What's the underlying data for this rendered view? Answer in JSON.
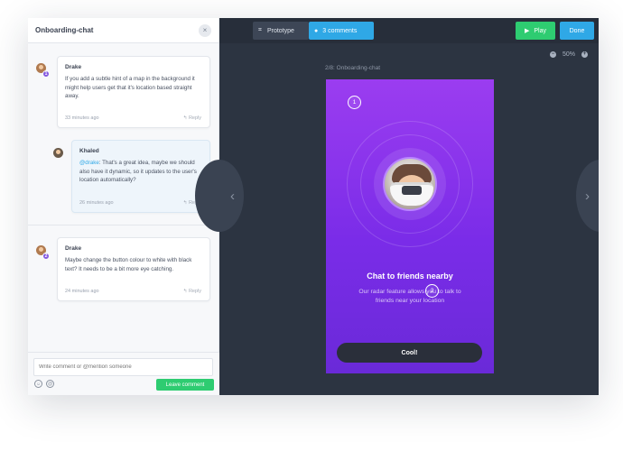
{
  "sidebar": {
    "title": "Onboarding-chat",
    "close_icon": "×",
    "threads": [
      {
        "author": "Drake",
        "badge": "1",
        "text": "If you add a subtle hint of a map in the background it might help users get that it's location based straight away.",
        "time": "33 minutes ago",
        "reply_label": "Reply"
      },
      {
        "author": "Khaled",
        "mention": "@drake",
        "text": ": That's a great idea, maybe we should also have it dynamic, so it updates to the user's location automatically?",
        "time": "26 minutes ago",
        "reply_label": "Reply"
      },
      {
        "author": "Drake",
        "badge": "2",
        "text": "Maybe change the button colour to white with black text? It needs to be a bit more eye catching.",
        "time": "24 minutes ago",
        "reply_label": "Reply"
      }
    ],
    "composer": {
      "placeholder": "Write comment or @mention someone",
      "leave_button": "Leave comment"
    }
  },
  "toolbar": {
    "prototype_label": "Prototype",
    "comments_label": "3 comments",
    "play_label": "Play",
    "done_label": "Done",
    "zoom_level": "50%"
  },
  "canvas": {
    "screen_label": "2/8: Onboarding-chat",
    "phone": {
      "title": "Chat to friends nearby",
      "subtitle": "Our radar feature allows you to talk to friends near your location",
      "button": "Cool!",
      "pin1": "1",
      "pin2": "2"
    }
  },
  "colors": {
    "accent": "#2fa8e6",
    "success": "#2ecc71",
    "badge": "#8358e0",
    "phone_gradient_top": "#9b3df0",
    "phone_gradient_bottom": "#6a2ad8"
  }
}
